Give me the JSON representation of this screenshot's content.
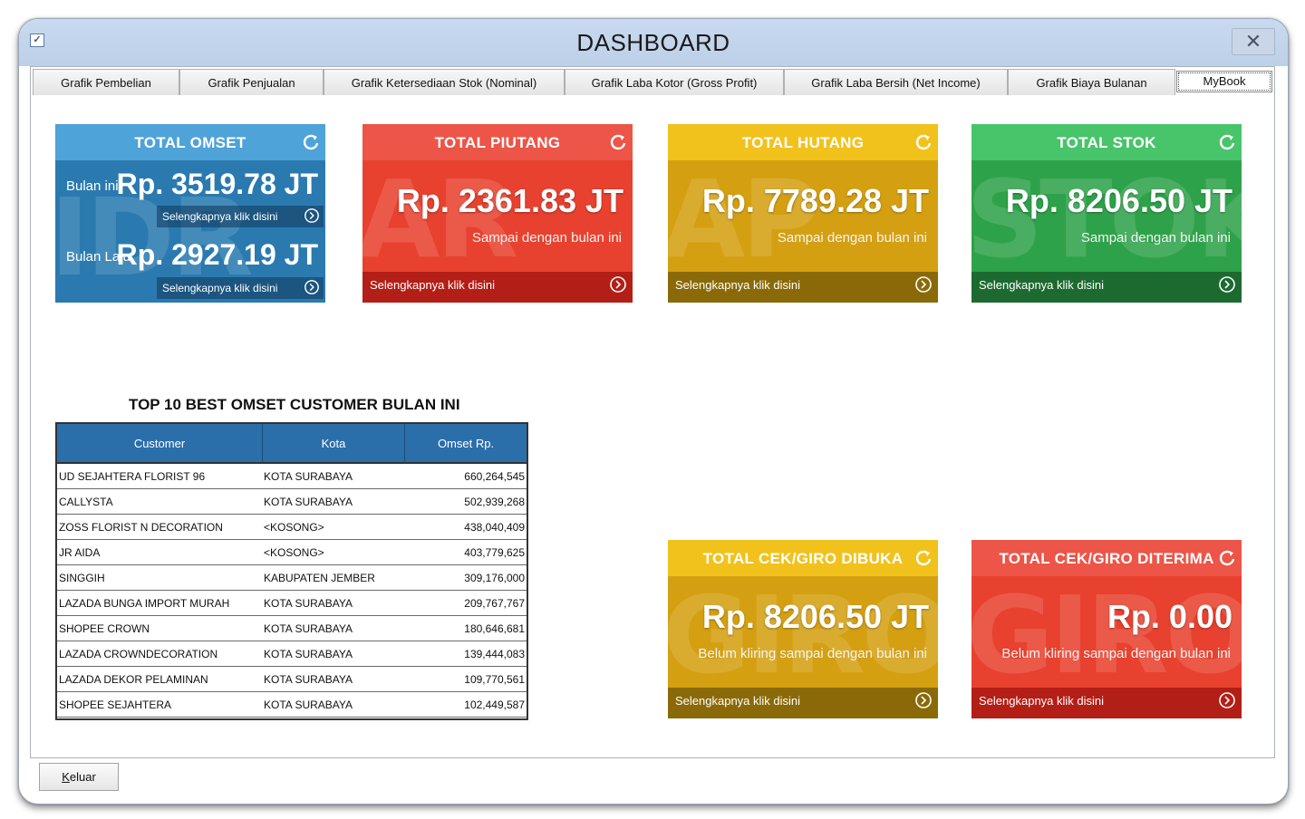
{
  "window": {
    "title": "DASHBOARD",
    "close_symbol": "✕",
    "icon": "app-icon"
  },
  "tabs": [
    {
      "label": "Grafik Pembelian"
    },
    {
      "label": "Grafik Penjualan"
    },
    {
      "label": "Grafik Ketersediaan Stok (Nominal)"
    },
    {
      "label": "Grafik Laba Kotor (Gross Profit)"
    },
    {
      "label": "Grafik Laba Bersih (Net Income)"
    },
    {
      "label": "Grafik Biaya Bulanan"
    },
    {
      "label": "MyBook",
      "active": true
    }
  ],
  "omset": {
    "title": "TOTAL OMSET",
    "bulan_ini_label": "Bulan ini",
    "bulan_ini_value": "Rp. 3519.78 JT",
    "bulan_lalu_label": "Bulan Lalu",
    "bulan_lalu_value": "Rp. 2927.19 JT",
    "link": "Selengkapnya klik disini",
    "color": "#2a7ab0"
  },
  "piutang": {
    "title": "TOTAL PIUTANG",
    "value": "Rp. 2361.83 JT",
    "sub": "Sampai dengan bulan ini",
    "link": "Selengkapnya klik disini",
    "color": "#e8412f"
  },
  "hutang": {
    "title": "TOTAL HUTANG",
    "value": "Rp. 7789.28 JT",
    "sub": "Sampai dengan bulan ini",
    "link": "Selengkapnya klik disini",
    "color": "#d4a012"
  },
  "stok": {
    "title": "TOTAL STOK",
    "value": "Rp. 8206.50 JT",
    "sub": "Sampai dengan bulan ini",
    "link": "Selengkapnya klik disini",
    "color": "#2ea24a"
  },
  "giro_dibuka": {
    "title": "TOTAL CEK/GIRO DIBUKA",
    "value": "Rp. 8206.50 JT",
    "sub": "Belum kliring sampai dengan bulan ini",
    "link": "Selengkapnya klik disini",
    "color": "#d4a012"
  },
  "giro_diterima": {
    "title": "TOTAL CEK/GIRO DITERIMA",
    "value": "Rp. 0.00",
    "sub": "Belum kliring sampai dengan bulan ini",
    "link": "Selengkapnya klik disini",
    "color": "#e8412f"
  },
  "top_customers": {
    "title": "TOP 10 BEST OMSET CUSTOMER BULAN INI",
    "columns": [
      "Customer",
      "Kota",
      "Omset Rp."
    ],
    "rows": [
      [
        "UD SEJAHTERA FLORIST 96",
        "KOTA SURABAYA",
        "660,264,545"
      ],
      [
        "CALLYSTA",
        "KOTA SURABAYA",
        "502,939,268"
      ],
      [
        "ZOSS FLORIST N DECORATION",
        "<KOSONG>",
        "438,040,409"
      ],
      [
        "JR AIDA",
        "<KOSONG>",
        "403,779,625"
      ],
      [
        "SINGGIH",
        "KABUPATEN JEMBER",
        "309,176,000"
      ],
      [
        "LAZADA BUNGA IMPORT MURAH",
        "KOTA SURABAYA",
        "209,767,767"
      ],
      [
        "SHOPEE CROWN",
        "KOTA SURABAYA",
        "180,646,681"
      ],
      [
        "LAZADA CROWNDECORATION",
        "KOTA SURABAYA",
        "139,444,083"
      ],
      [
        "LAZADA DEKOR PELAMINAN",
        "KOTA SURABAYA",
        "109,770,561"
      ],
      [
        "SHOPEE SEJAHTERA",
        "KOTA SURABAYA",
        "102,449,587"
      ]
    ]
  },
  "footer": {
    "keluar_underlined": "K",
    "keluar_rest": "eluar"
  }
}
